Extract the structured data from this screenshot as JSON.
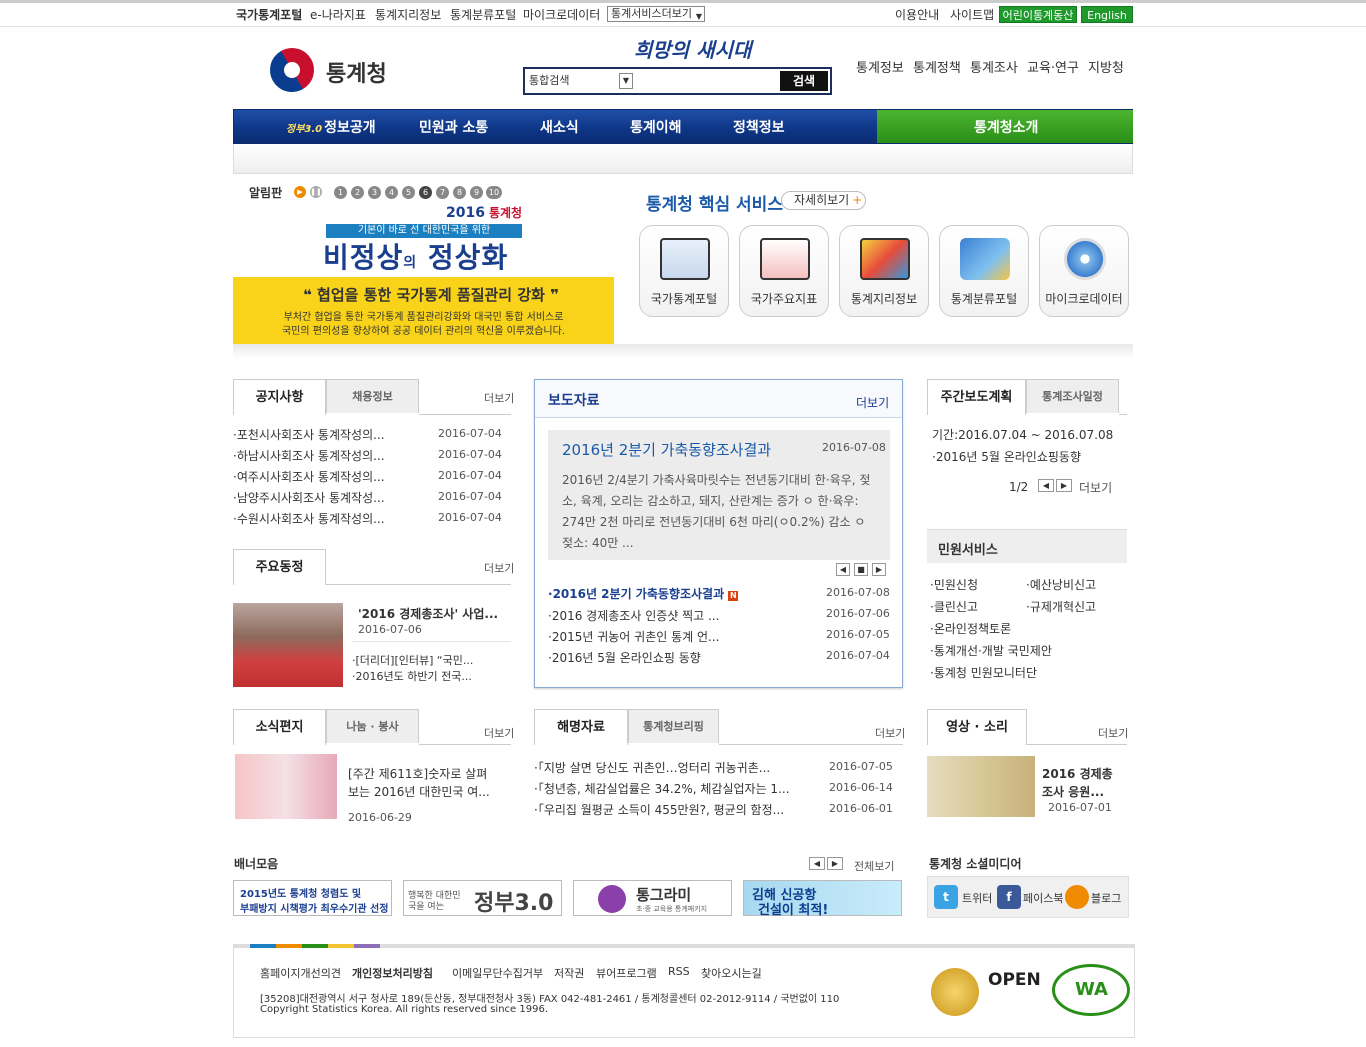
{
  "topbar": {
    "links": [
      "국가통계포털",
      "e-나라지표",
      "통계지리정보",
      "통계분류포털",
      "마이크로데이터"
    ],
    "more_select": "통계서비스더보기",
    "right_links": [
      "이용안내",
      "사이트맵"
    ],
    "kids_button": "어린이통계동산",
    "english_button": "English"
  },
  "header": {
    "logo_text": "통계청",
    "slogan": "희망의 새시대",
    "search_select": "통합검색",
    "search_button": "검색",
    "menu": [
      "통계정보",
      "통계정책",
      "통계조사",
      "교육·연구",
      "지방청"
    ]
  },
  "gnb": {
    "gov_badge": "정부3.0",
    "items": [
      "정보공개",
      "민원과 소통",
      "새소식",
      "통계이해",
      "정책정보"
    ],
    "highlight": "통계청소개"
  },
  "banner": {
    "label": "알림판",
    "numbers": [
      "1",
      "2",
      "3",
      "4",
      "5",
      "6",
      "7",
      "8",
      "9",
      "10"
    ],
    "year": "2016",
    "org": "통계청",
    "sub": "기본이 바로 선 대한민국을 위한",
    "main_a": "비정상",
    "main_b": "의",
    "main_c": "정상화",
    "quote": "❝ 협업을 통한 국가통계 품질관리 강화 ❞",
    "desc1": "부처간 협업을 통한 국가통계 품질관리강화와 대국민 통합 서비스로",
    "desc2": "국민의 편의성을 향상하여 공공 데이터 관리의 혁신을 이루겠습니다."
  },
  "core": {
    "title_a": "통계청",
    "title_b": " 핵심 서비스",
    "more": "자세히보기",
    "services": [
      "국가통계포털",
      "국가주요지표",
      "통계지리정보",
      "통계분류포털",
      "마이크로데이터"
    ]
  },
  "notice": {
    "tab_on": "공지사항",
    "tab_off": "채용정보",
    "more": "더보기",
    "items": [
      {
        "title": "포천시사회조사 통계작성의...",
        "date": "2016-07-04"
      },
      {
        "title": "하남시사회조사 통계작성의...",
        "date": "2016-07-04"
      },
      {
        "title": "여주시사회조사 통계작성의...",
        "date": "2016-07-04"
      },
      {
        "title": "남양주시사회조사 통계작성...",
        "date": "2016-07-04"
      },
      {
        "title": "수원시사회조사 통계작성의...",
        "date": "2016-07-04"
      }
    ]
  },
  "activity": {
    "tab": "주요동정",
    "more": "더보기",
    "main_title": "'2016 경제총조사' 사업...",
    "main_date": "2016-07-06",
    "items": [
      "[더리더][인터뷰] “국민...",
      "2016년도 하반기 전국..."
    ]
  },
  "press": {
    "title": "보도자료",
    "more": "더보기",
    "feature_title": "2016년 2분기 가축동향조사결과",
    "feature_date": "2016-07-08",
    "feature_body": "2016년 2/4분기 가축사육마릿수는 전년동기대비 한·육우, 젖소, 육계, 오리는 감소하고, 돼지, 산란계는 증가 ㅇ 한·육우: 274만 2천 마리로 전년동기대비 6천 마리(ㅇ0.2%) 감소 ㅇ 젖소: 40만 ...",
    "items": [
      {
        "title": "2016년 2분기 가축동향조사결과",
        "date": "2016-07-08"
      },
      {
        "title": "2016 경제총조사 인증샷 찍고 ...",
        "date": "2016-07-06"
      },
      {
        "title": "2015년 귀농어 귀촌인 통계 언...",
        "date": "2016-07-05"
      },
      {
        "title": "2016년 5월 온라인쇼핑 동향",
        "date": "2016-07-04"
      }
    ],
    "new_badge": "N"
  },
  "weekly": {
    "tab_on": "주간보도계획",
    "tab_off": "통계조사일정",
    "period": "기간:2016.07.04 ~ 2016.07.08",
    "item": "2016년 5월 온라인쇼핑동향",
    "page": "1/2",
    "more": "더보기"
  },
  "civil": {
    "title": "민원서비스",
    "left": [
      "민원신청",
      "클린신고",
      "온라인정책토론",
      "통계개선·개발 국민제안",
      "통계청 민원모니터단"
    ],
    "right": [
      "예산낭비신고",
      "규제개혁신고"
    ]
  },
  "letter": {
    "tab_on": "소식편지",
    "tab_off": "나눔 · 봉사",
    "more": "더보기",
    "title_line1": "[주간 제611호]숫자로 살펴",
    "title_line2": "보는 2016년 대한민국 여...",
    "date": "2016-06-29"
  },
  "explain": {
    "tab_on": "해명자료",
    "tab_off": "통계청브리핑",
    "more": "더보기",
    "items": [
      {
        "title": "「지방 살면 당신도 귀촌인…엉터리 귀농귀촌...",
        "date": "2016-07-05"
      },
      {
        "title": "「청년층, 체감실업률은 34.2%, 체감실업자는 1...",
        "date": "2016-06-14"
      },
      {
        "title": "「우리집 월평균 소득이 455만원?, 평균의 함정...",
        "date": "2016-06-01"
      }
    ]
  },
  "video": {
    "tab": "영상 · 소리",
    "more": "더보기",
    "title_line1": "2016 경제총",
    "title_line2": "조사 응원...",
    "date": "2016-07-01"
  },
  "banners": {
    "title": "배너모음",
    "all": "전체보기",
    "b1_line1": "2015년도 통계청 청렴도 및",
    "b1_line2": "부패방지 시책평가 최우수기관 선정",
    "b2_small": "행복한 대한민국을 여는",
    "b2_big": "정부3.0",
    "b3_big": "통그라미",
    "b3_small": "초·중 교육용 통계패키지",
    "b4_line1": "김해 신공항",
    "b4_line2": "건설이 최적!"
  },
  "social": {
    "title": "통계청 소셜미디어",
    "items": [
      "트위터",
      "페이스북",
      "블로그"
    ]
  },
  "footer": {
    "links": [
      "홈페이지개선의견",
      "개인정보처리방침",
      "이메일무단수집거부",
      "저작권",
      "뷰어프로그램",
      "RSS",
      "찾아오시는길"
    ],
    "address": "[35208]대전광역시 서구 청사로 189(둔산동, 정부대전청사 3동) FAX 042-481-2461 / 통계청콜센터 02-2012-9114 / 국번없이 110",
    "copyright": "Copyright Statistics Korea. All rights reserved since 1996.",
    "badge_open": "OPEN",
    "badge_wa": "WA"
  },
  "colors": {
    "navy": "#0e3585",
    "green": "#2a8f18",
    "accent_blue": "#1b5aa8",
    "yellow": "#f8d31a"
  }
}
